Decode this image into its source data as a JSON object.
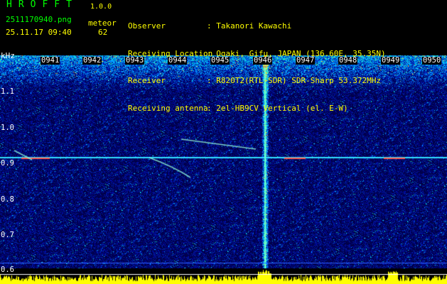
{
  "header": {
    "app_title": "HROFFT",
    "app_version": "1.0.0",
    "file_name": "2511170940.png",
    "datetime": "25.11.17 09:40",
    "meteor_label": "meteor",
    "meteor_count": "62"
  },
  "info": {
    "labels": [
      "Observer",
      "Receiving Location",
      "Receiver",
      "Receiving antenna"
    ],
    "values": [
      ": Takanori Kawachi",
      ": Ogaki, Gifu, JAPAN (136.60E, 35.35N)",
      ": R820T2(RTL-SDR) SDR-Sharp 53.372MHz",
      ": 2el-HB9CV Vertical (el. E-W)"
    ]
  },
  "y_axis": {
    "unit": "kHz",
    "ticks": [
      "1.1",
      "1.0",
      "0.9",
      "0.8",
      "0.7",
      "0.6"
    ]
  },
  "x_axis": {
    "ticks": [
      "0941",
      "0942",
      "0943",
      "0944",
      "0945",
      "0946",
      "0947",
      "0948",
      "0949",
      "0950"
    ]
  },
  "colors": {
    "background": "#000000",
    "label_green": "#00ff00",
    "label_yellow": "#ffff00",
    "label_white": "#ffffff",
    "spectro_low": "#00005a",
    "spectro_high": "#ff3030",
    "carrier_line": "#00e0ff",
    "amplitude_bar": "#ffff00"
  }
}
